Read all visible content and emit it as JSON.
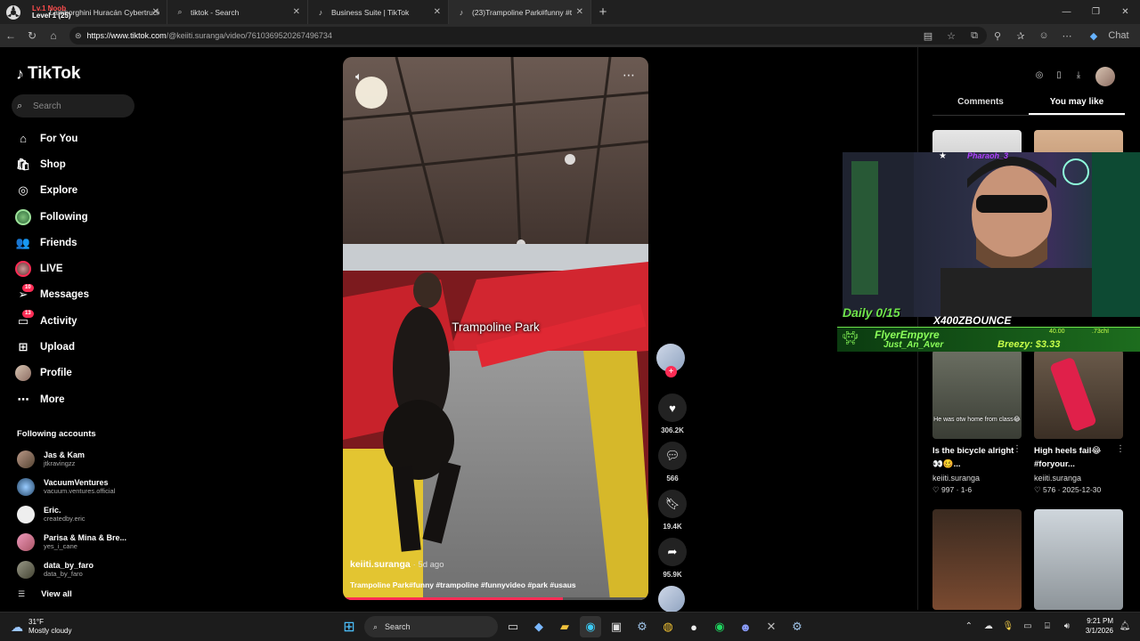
{
  "browser": {
    "tabs": [
      {
        "label": "Lamborghini Huracán Cybertruck - Ambient City D",
        "favicon": "game-icon"
      },
      {
        "label": "tiktok - Search",
        "favicon": "search-icon"
      },
      {
        "label": "Business Suite | TikTok",
        "favicon": "tiktok-icon"
      },
      {
        "label": "(23)Trampoline Park#funny #t",
        "favicon": "tiktok-icon"
      }
    ],
    "tab_overlay_line1": "Lv.1 Noob",
    "tab_overlay_line2": "Level 1 (25)",
    "url_host": "https://www.tiktok.com",
    "url_path": "/@keiiti.suranga/video/7610369520267496734",
    "chat_label": "Chat"
  },
  "sidebar": {
    "logo": "TikTok",
    "search_placeholder": "Search",
    "nav": [
      {
        "label": "For You",
        "icon": "home-icon"
      },
      {
        "label": "Shop",
        "icon": "shop-icon"
      },
      {
        "label": "Explore",
        "icon": "compass-icon"
      },
      {
        "label": "Following",
        "icon": "following-avatar-icon"
      },
      {
        "label": "Friends",
        "icon": "friends-icon"
      },
      {
        "label": "LIVE",
        "icon": "live-icon"
      },
      {
        "label": "Messages",
        "icon": "messages-icon",
        "badge": "10"
      },
      {
        "label": "Activity",
        "icon": "activity-icon",
        "badge": "13"
      },
      {
        "label": "Upload",
        "icon": "upload-icon"
      },
      {
        "label": "Profile",
        "icon": "profile-icon"
      },
      {
        "label": "More",
        "icon": "more-icon"
      }
    ],
    "following_heading": "Following accounts",
    "following": [
      {
        "name": "Jas & Kam",
        "handle": "jtkravingzz"
      },
      {
        "name": "VacuumVentures",
        "handle": "vacuum.ventures.official"
      },
      {
        "name": "Eric.",
        "handle": "createdby.eric"
      },
      {
        "name": "Parisa & Mina & Bre...",
        "handle": "yes_i_cane"
      },
      {
        "name": "data_by_faro",
        "handle": "data_by_faro"
      }
    ],
    "view_all": "View all"
  },
  "video": {
    "overlay_text": "Trampoline Park",
    "author": "keiiti.suranga",
    "age": "· 5d ago",
    "description": "Trampoline Park#funny #trampoline #funnyvideo #park #usaus",
    "progress": 0.72,
    "likes": "306.2K",
    "comments": "566",
    "saves": "19.4K",
    "shares": "95.9K"
  },
  "right_panel": {
    "tabs": [
      "Comments",
      "You may like"
    ],
    "active_tab": "You may like",
    "recs": [
      {
        "thumb_caption": "He was otw home from class😂",
        "title": "Is the bicycle alright👀🥴...",
        "author": "keiiti.suranga",
        "likes": "997",
        "meta": "1-6"
      },
      {
        "thumb_caption": "",
        "title": "High heels fail😂 #foryour...",
        "author": "keiiti.suranga",
        "likes": "576",
        "meta": "2025-12-30"
      }
    ]
  },
  "overlay": {
    "star": "★",
    "streamer_tag": "Pharaoh_3",
    "daily": "Daily 0/15",
    "title": "X400ZBOUNCE",
    "flyer": "FlyerEmpyre",
    "just": "Just_An_Aver",
    "breezy": "Breezy: $3.33",
    "amt1": "40.00",
    "amt2": ".73chI"
  },
  "taskbar": {
    "temp": "31°F",
    "condition": "Mostly cloudy",
    "search_label": "Search",
    "time": "9:21 PM",
    "date": "3/1/2026"
  },
  "colors": {
    "accent": "#fe2c55",
    "overlay_green": "#6fe34b"
  }
}
